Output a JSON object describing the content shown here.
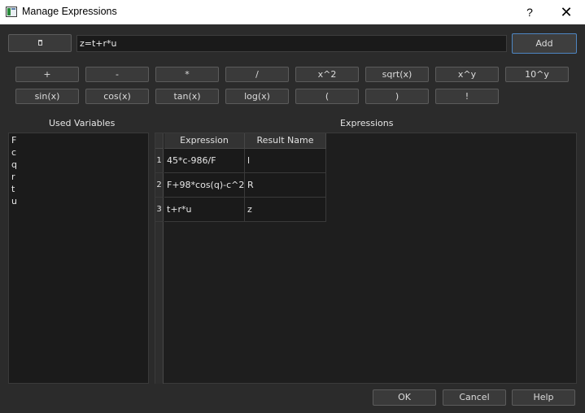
{
  "window": {
    "title": "Manage Expressions",
    "help_glyph": "?",
    "close_glyph": "✕"
  },
  "input": {
    "value": "z=t+r*u"
  },
  "toolbar": {
    "add_label": "Add"
  },
  "operators": {
    "row1": [
      "+",
      "-",
      "*",
      "/",
      "x^2",
      "sqrt(x)",
      "x^y",
      "10^y"
    ],
    "row2": [
      "sin(x)",
      "cos(x)",
      "tan(x)",
      "log(x)",
      "(",
      ")",
      "!"
    ]
  },
  "labels": {
    "used_variables": "Used Variables",
    "expressions": "Expressions"
  },
  "variables": [
    "F",
    "c",
    "q",
    "r",
    "t",
    "u"
  ],
  "table": {
    "headers": [
      "Expression",
      "Result Name"
    ],
    "rows": [
      {
        "num": "1",
        "expression": "45*c-986/F",
        "result": "l"
      },
      {
        "num": "2",
        "expression": "F+98*cos(q)-c^2",
        "result": "R"
      },
      {
        "num": "3",
        "expression": "t+r*u",
        "result": "z"
      }
    ]
  },
  "footer": {
    "ok_label": "OK",
    "cancel_label": "Cancel",
    "help_label": "Help"
  }
}
